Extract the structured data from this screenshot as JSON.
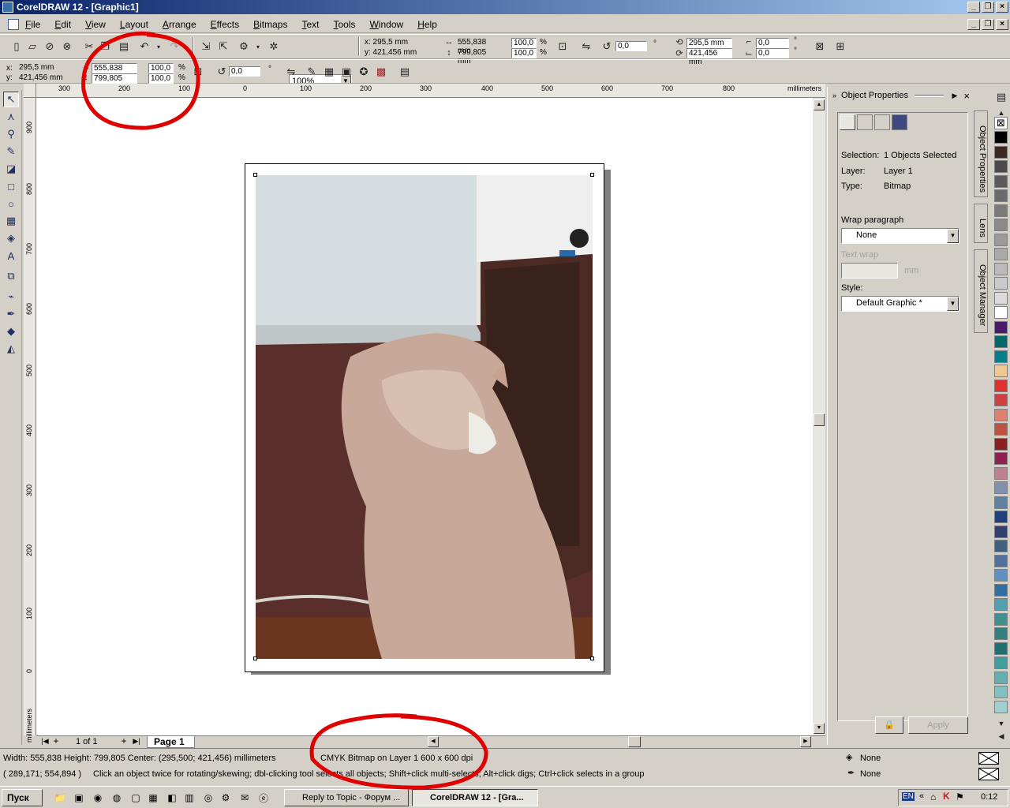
{
  "window": {
    "title": "CorelDRAW 12 - [Graphic1]"
  },
  "menu": [
    "File",
    "Edit",
    "View",
    "Layout",
    "Arrange",
    "Effects",
    "Bitmaps",
    "Text",
    "Tools",
    "Window",
    "Help"
  ],
  "toolbar": {
    "zoom": "100%",
    "x": "x: 295,5 mm",
    "y": "y: 421,456 mm",
    "width": "555,838 mm",
    "height": "799,805 mm",
    "scale_x": "100,0",
    "scale_y": "100,0",
    "pct": "%",
    "rotation": "0,0",
    "deg": "°",
    "center_x": "295,5 mm",
    "center_y": "421,456 mm",
    "skew_x": "0,0",
    "skew_y": "0,0"
  },
  "propbar": {
    "x": "295,5 mm",
    "y": "421,456 mm",
    "x_label": "x:",
    "y_label": "y:",
    "width": "555,838 mm",
    "height": "799,805 mm",
    "scale_x": "100,0",
    "scale_y": "100,0",
    "pct": "%",
    "rotation": "0,0",
    "deg": "°"
  },
  "ruler": {
    "h_ticks": [
      "300",
      "200",
      "100",
      "0",
      "100",
      "200",
      "300",
      "400",
      "500",
      "600",
      "700",
      "800"
    ],
    "v_ticks": [
      "900",
      "800",
      "700",
      "600",
      "500",
      "400",
      "300",
      "200",
      "100",
      "0"
    ],
    "unit": "millimeters"
  },
  "pager": {
    "count": "1 of 1",
    "page_tab": "Page 1"
  },
  "docker": {
    "title": "Object Properties",
    "selection_label": "Selection:",
    "selection_value": "1 Objects Selected",
    "layer_label": "Layer:",
    "layer_value": "Layer 1",
    "type_label": "Type:",
    "type_value": "Bitmap",
    "wrap_label": "Wrap paragraph",
    "wrap_value": "None",
    "textwrap_label": "Text wrap",
    "textwrap_unit": "mm",
    "style_label": "Style:",
    "style_value": "Default Graphic *",
    "apply_label": "Apply"
  },
  "side_tabs": [
    "Object Properties",
    "Lens",
    "Object Manager"
  ],
  "palette": [
    "#000000",
    "#3c2a20",
    "#4a4a4a",
    "#5a5a5a",
    "#6a6a6a",
    "#7a7a7a",
    "#8a8a8a",
    "#9a9a9a",
    "#aaaaaa",
    "#bababa",
    "#cacaca",
    "#dadada",
    "#ffffff",
    "#4a1a6a",
    "#006a6a",
    "#00808a",
    "#f0c890",
    "#e03030",
    "#d04040",
    "#e08070",
    "#c05040",
    "#8a2020",
    "#902050",
    "#c08090",
    "#8090b0",
    "#6080a0",
    "#204080",
    "#304070",
    "#406080",
    "#5070a0",
    "#6090c0",
    "#3070a0",
    "#50a0b0",
    "#409090",
    "#308080",
    "#207070",
    "#40a0a0",
    "#60b0b0",
    "#80c0c0",
    "#a0d0d0"
  ],
  "status": {
    "dimensions": "Width: 555,838  Height: 799,805  Center: (295,500; 421,456)  millimeters",
    "object_info": "CMYK Bitmap on Layer 1 600 x 600 dpi",
    "cursor": "( 289,171; 554,894 )",
    "hint": "Click an object twice for rotating/skewing; dbl-clicking tool selects all objects; Shift+click multi-selects; Alt+click digs; Ctrl+click selects in a group",
    "fill": "None",
    "outline": "None"
  },
  "taskbar": {
    "start": "Пуск",
    "tasks": [
      "Reply to Topic - Форум ...",
      "CorelDRAW 12 - [Gra..."
    ],
    "lang": "EN",
    "clock": "0:12"
  }
}
